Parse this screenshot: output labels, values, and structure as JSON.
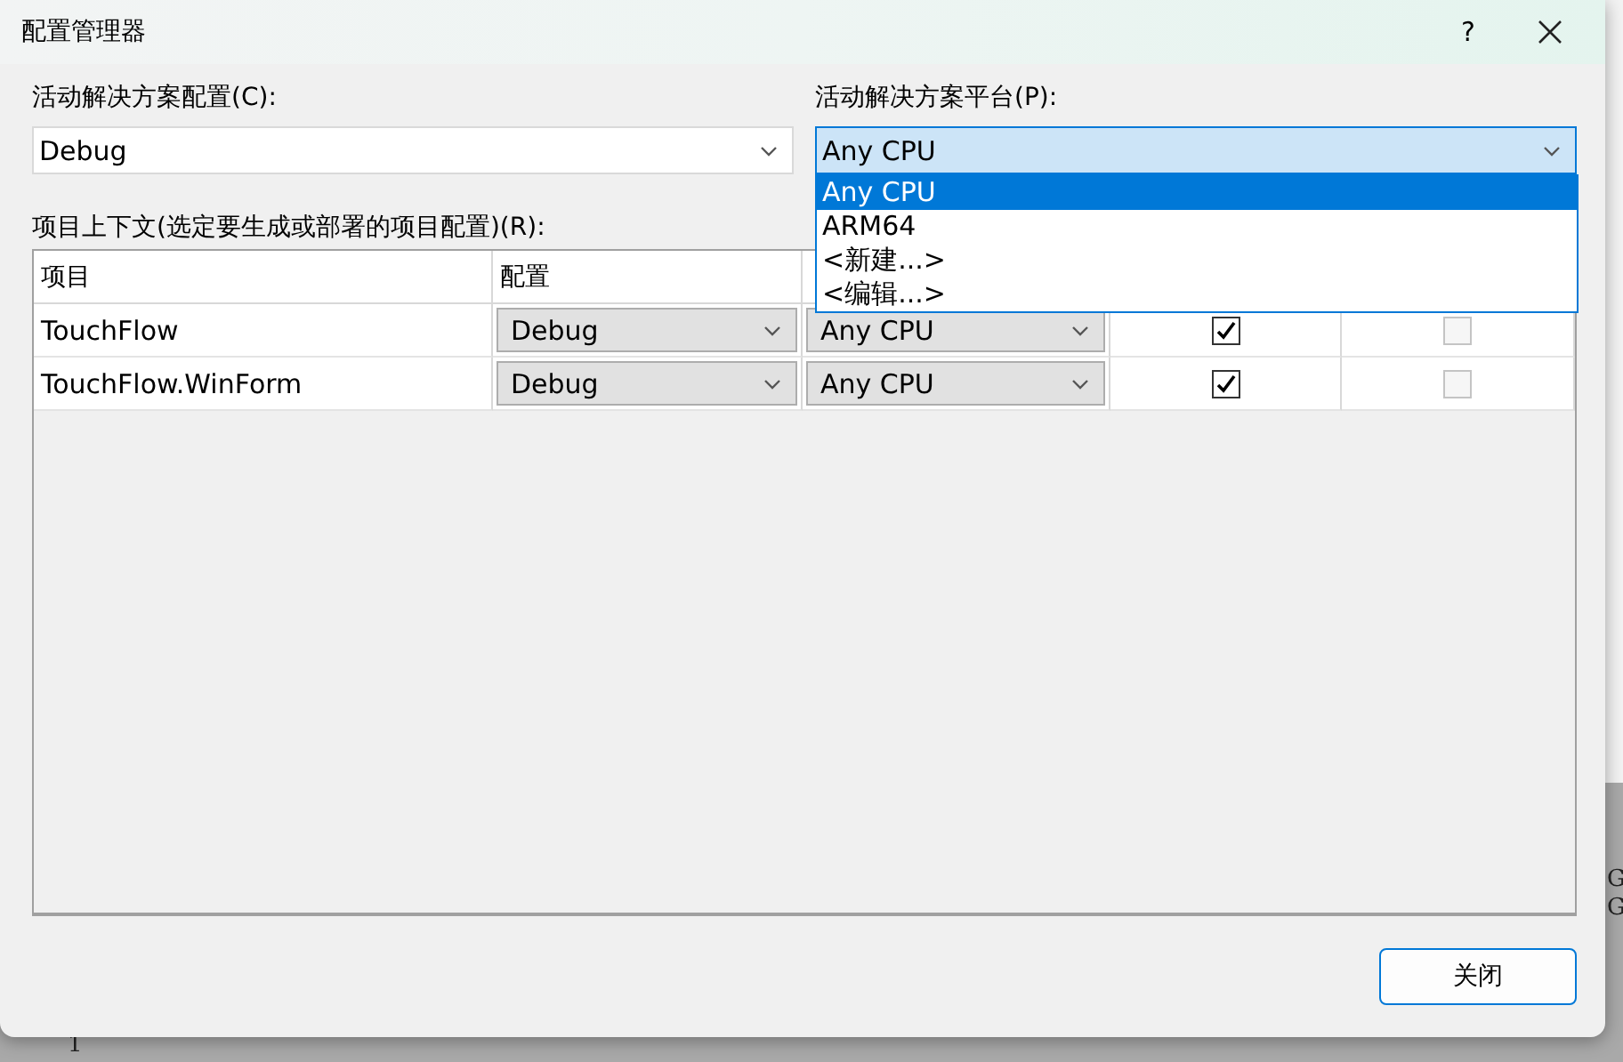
{
  "dialog": {
    "title": "配置管理器",
    "help_button": "?",
    "config_label": "活动解决方案配置(C):",
    "config_value": "Debug",
    "platform_label": "活动解决方案平台(P):",
    "platform_value": "Any CPU",
    "platform_options": [
      {
        "label": "Any CPU",
        "selected": true
      },
      {
        "label": "ARM64",
        "selected": false
      },
      {
        "label": "<新建...>",
        "selected": false
      },
      {
        "label": "<编辑...>",
        "selected": false
      }
    ],
    "context_label": "项目上下文(选定要生成或部署的项目配置)(R):",
    "columns": [
      "项目",
      "配置"
    ],
    "rows": [
      {
        "project": "TouchFlow",
        "configuration": "Debug",
        "platform": "Any CPU",
        "build": true,
        "deploy": false
      },
      {
        "project": "TouchFlow.WinForm",
        "configuration": "Debug",
        "platform": "Any CPU",
        "build": true,
        "deploy": false
      }
    ],
    "close_button": "关闭"
  },
  "background": {
    "texts": [
      "G",
      "G",
      "1"
    ]
  }
}
